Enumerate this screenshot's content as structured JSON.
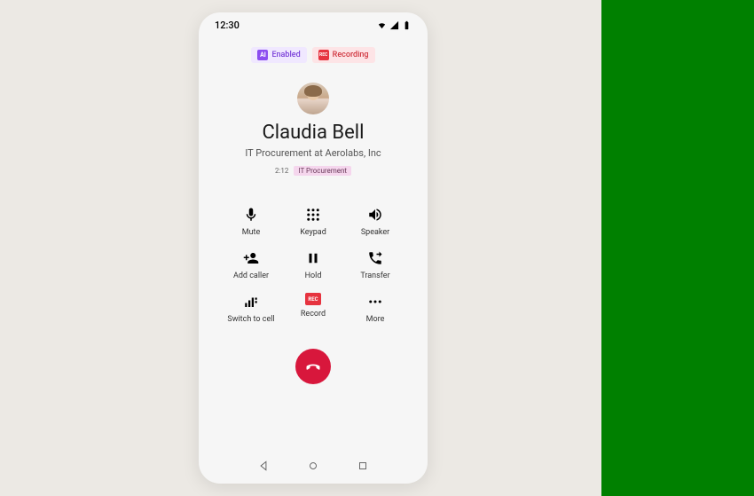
{
  "status": {
    "time": "12:30"
  },
  "badges": {
    "enabled_label": "Enabled",
    "enabled_icon_text": "AI",
    "recording_label": "Recording",
    "recording_icon_text": "REC"
  },
  "caller": {
    "name": "Claudia Bell",
    "subtitle": "IT Procurement at Aerolabs, Inc",
    "time": "2:12",
    "tag": "IT Procurement"
  },
  "controls": {
    "mute": "Mute",
    "keypad": "Keypad",
    "speaker": "Speaker",
    "add_caller": "Add caller",
    "hold": "Hold",
    "transfer": "Transfer",
    "switch_to_cell": "Switch to cell",
    "record": "Record",
    "record_icon_text": "REC",
    "more": "More"
  }
}
